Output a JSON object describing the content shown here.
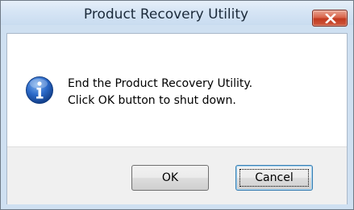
{
  "window": {
    "title": "Product Recovery Utility",
    "close_icon": "close-x-icon",
    "colors": {
      "title_bar": "#d6e5f5",
      "close_button": "#c1391f",
      "button_area": "#f0f0f0",
      "info_icon": "#1f5fb4"
    }
  },
  "message": {
    "icon": "info-icon",
    "line1": "End the Product Recovery Utility.",
    "line2": "Click OK button to shut down."
  },
  "buttons": {
    "ok_label": "OK",
    "cancel_label": "Cancel",
    "focused": "Cancel"
  }
}
